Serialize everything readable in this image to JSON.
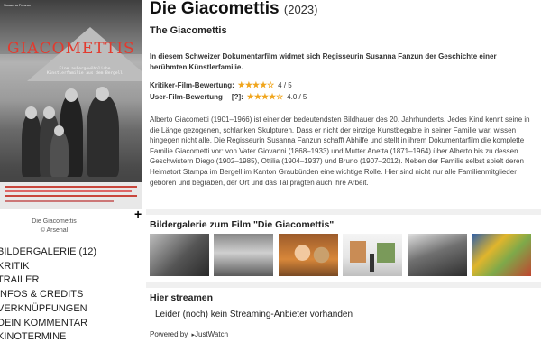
{
  "poster": {
    "top_text": "Susanna Fanzun",
    "title": "GIACOMETTIS",
    "subtitle": "Eine außergewöhnliche Künstlerfamilie aus dem Bergell",
    "caption_title": "Die Giacomettis",
    "caption_credit": "© Arsenal"
  },
  "side_nav": {
    "items": [
      {
        "label": "Bildergalerie (12)"
      },
      {
        "label": "Kritik"
      },
      {
        "label": "Trailer"
      },
      {
        "label": "Infos & Credits"
      },
      {
        "label": "Verknüpfungen"
      },
      {
        "label": "Dein Kommentar"
      },
      {
        "label": "Kinotermine"
      }
    ]
  },
  "movie": {
    "title": "Die Giacomettis",
    "year": "(2023)",
    "subtitle": "The Giacomettis",
    "lead": "In diesem Schweizer Dokumentarfilm widmet sich Regisseurin Susanna Fanzun der Geschichte einer berühmten Künstlerfamilie.",
    "critic_label": "Kritiker-Film-Bewertung:",
    "critic_stars": "★★★★☆",
    "critic_score": "4 / 5",
    "critic_rating": 4,
    "user_label": "User-Film-Bewertung",
    "user_help": "[?]:",
    "user_stars": "★★★★☆",
    "user_score": "4.0 / 5",
    "user_rating": 4.0,
    "description": "Alberto Giacometti (1901–1966) ist einer der bedeutendsten Bildhauer des 20. Jahrhunderts. Jedes Kind kennt seine in die Länge gezogenen, schlanken Skulpturen. Dass er nicht der einzige Kunstbegabte in seiner Familie war, wissen hingegen nicht alle. Die Regisseurin Susanna Fanzun schafft Abhilfe und stellt in ihrem Dokumentarfilm die komplette Familie Giacometti vor: von Vater Giovanni (1868–1933) und Mutter Anetta (1871–1964) über Alberto bis zu dessen Geschwistern Diego (1902–1985), Ottilia (1904–1937) und Bruno (1907–2012). Neben der Familie selbst spielt deren Heimatort Stampa im Bergell im Kanton Graubünden eine wichtige Rolle. Hier sind nicht nur alle Familienmitglieder geboren und begraben, der Ort und das Tal prägten auch ihre Arbeit."
  },
  "gallery": {
    "title": "Bildergalerie zum Film \"Die Giacomettis\""
  },
  "streaming": {
    "title": "Hier streamen",
    "message": "Leider (noch) kein Streaming-Anbieter vorhanden",
    "powered_by": "Powered by",
    "provider": "JustWatch"
  },
  "colors": {
    "star": "#f0a51c",
    "poster_title": "#e23a2e"
  }
}
